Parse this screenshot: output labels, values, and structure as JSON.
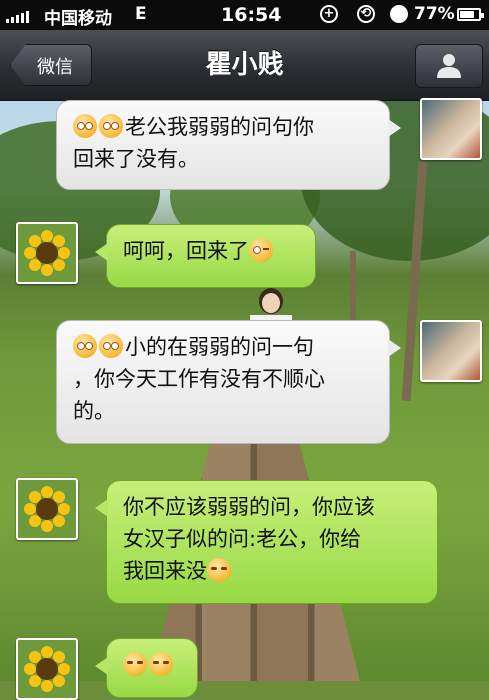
{
  "status_bar": {
    "carrier": "中国移动",
    "network": "E",
    "time": "16:54",
    "battery": "77%",
    "battery_level": 0.77
  },
  "nav": {
    "back_label": "微信",
    "title": "瞿小贱",
    "profile_icon": "person-icon"
  },
  "messages": [
    {
      "side": "left",
      "text": "老公我弱弱的问句你回来了没有。",
      "line1": "老公我弱弱的问句你",
      "line2": "回来了没有。",
      "emoji": [
        "cry-emoji",
        "cry-emoji"
      ]
    },
    {
      "side": "right",
      "text": "呵呵，回来了",
      "emoji_after": "wink-emoji"
    },
    {
      "side": "left",
      "text": "小的在弱弱的问一句，你今天工作有没有不顺心的。",
      "line1": "小的在弱弱的问一句",
      "line2": "，你今天工作有没有不顺心",
      "line3": "的。",
      "emoji": [
        "cry-emoji",
        "cry-emoji"
      ]
    },
    {
      "side": "right",
      "text": "你不应该弱弱的问，你应该女汉子似的问:老公，你给我回来没",
      "line1": "你不应该弱弱的问，你应该",
      "line2": "女汉子似的问:老公，你给",
      "line3": "我回来没",
      "emoji_after": "laugh-emoji"
    },
    {
      "side": "right",
      "text": "",
      "emoji": [
        "shy-emoji",
        "shy-emoji"
      ]
    }
  ]
}
